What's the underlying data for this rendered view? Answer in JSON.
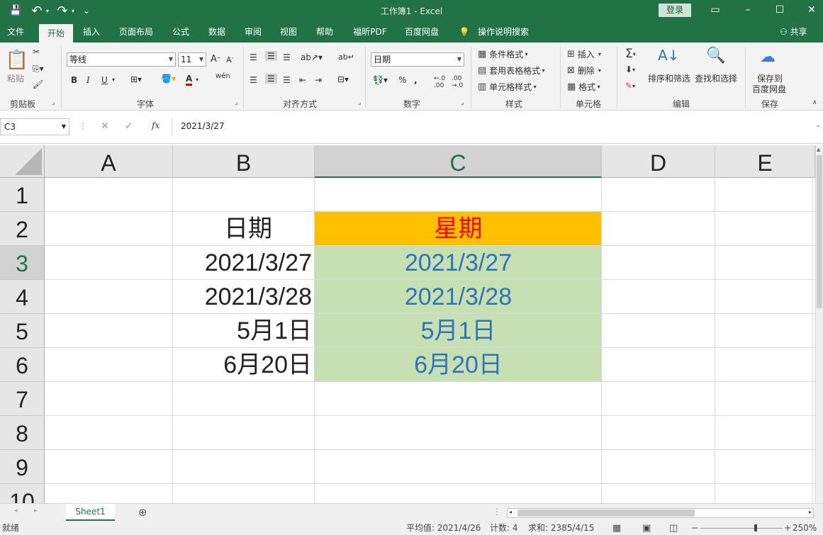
{
  "titlebar": {
    "title": "工作簿1  -  Excel",
    "login_label": "登录",
    "save_glyph": "💾",
    "undo_glyph": "↶",
    "redo_glyph": "↷",
    "qat_more_glyph": "⌄",
    "ribbon_options_glyph": "▭",
    "minimize_glyph": "–",
    "maximize_glyph": "☐",
    "close_glyph": "✕"
  },
  "tabs": [
    "文件",
    "开始",
    "插入",
    "页面布局",
    "公式",
    "数据",
    "审阅",
    "视图",
    "帮助",
    "福昕PDF",
    "百度网盘",
    "操作说明搜索"
  ],
  "active_tab": "开始",
  "share_label": "共享",
  "ribbon": {
    "clipboard": {
      "paste_label": "粘贴",
      "group_label": "剪贴板"
    },
    "font": {
      "font_name": "等线",
      "font_size": "11",
      "group_label": "字体"
    },
    "alignment": {
      "group_label": "对齐方式"
    },
    "number": {
      "format": "日期",
      "group_label": "数字"
    },
    "styles": {
      "conditional": "条件格式",
      "table": "套用表格格式",
      "cell_styles": "单元格样式",
      "group_label": "样式"
    },
    "cells": {
      "insert": "插入",
      "delete": "删除",
      "format": "格式",
      "group_label": "单元格"
    },
    "editing": {
      "sort_filter": "排序和筛选",
      "find_select": "查找和选择",
      "group_label": "编辑"
    },
    "save": {
      "save_to": "保存到",
      "baidu": "百度网盘",
      "group_label": "保存"
    }
  },
  "formula_bar": {
    "name_box": "C3",
    "formula": "2021/3/27"
  },
  "grid": {
    "columns": [
      "A",
      "B",
      "C",
      "D",
      "E"
    ],
    "rows": [
      "1",
      "2",
      "3",
      "4",
      "5",
      "6",
      "7",
      "8",
      "9",
      "10"
    ],
    "cells": {
      "B2": "日期",
      "C2": "星期",
      "B3": "2021/3/27",
      "C3": "2021/3/27",
      "B4": "2021/3/28",
      "C4": "2021/3/28",
      "B5": "5月1日",
      "C5": "5月1日",
      "B6": "6月20日",
      "C6": "6月20日"
    }
  },
  "colors": {
    "accent": "#217346",
    "header_fill": "#FFC000",
    "header_text": "#FF0000",
    "data_fill": "#C6E0B4",
    "data_text": "#2E75B6"
  },
  "sheet_tab": "Sheet1",
  "statusbar": {
    "ready": "就绪",
    "average": "平均值: 2021/4/26",
    "count": "计数: 4",
    "sum": "求和: 2385/4/15",
    "zoom": "250%"
  }
}
